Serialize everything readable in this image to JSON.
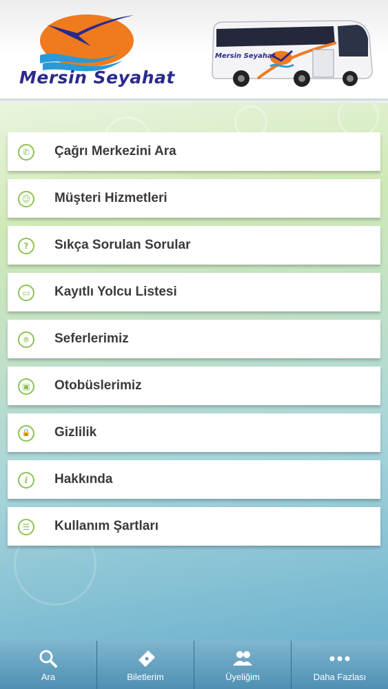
{
  "header": {
    "logo_text": "Mersin Seyahat",
    "bus_text": "Mersin Seyahat"
  },
  "menu": {
    "items": [
      {
        "label": "Çağrı Merkezini Ara",
        "icon": "phone-icon",
        "glyph": "✆"
      },
      {
        "label": "Müşteri Hizmetleri",
        "icon": "customer-service-icon",
        "glyph": "☺"
      },
      {
        "label": "Sıkça Sorulan Sorular",
        "icon": "question-icon",
        "glyph": "?"
      },
      {
        "label": "Kayıtlı Yolcu Listesi",
        "icon": "list-card-icon",
        "glyph": "▭"
      },
      {
        "label": "Seferlerimiz",
        "icon": "location-pin-icon",
        "glyph": "⌾"
      },
      {
        "label": "Otobüslerimiz",
        "icon": "bus-icon",
        "glyph": "▣"
      },
      {
        "label": "Gizlilik",
        "icon": "lock-icon",
        "glyph": "🔒"
      },
      {
        "label": "Hakkında",
        "icon": "info-icon",
        "glyph": "i"
      },
      {
        "label": "Kullanım Şartları",
        "icon": "terms-list-icon",
        "glyph": "☰"
      }
    ]
  },
  "tabbar": {
    "search": "Ara",
    "tickets": "Biletlerim",
    "membership": "Üyeliğim",
    "more": "Daha Fazlası"
  },
  "colors": {
    "accent_green": "#8cc252",
    "brand_blue": "#2b2a8c",
    "brand_orange": "#f07a1e",
    "tabbar_blue": "#4f90b2"
  }
}
